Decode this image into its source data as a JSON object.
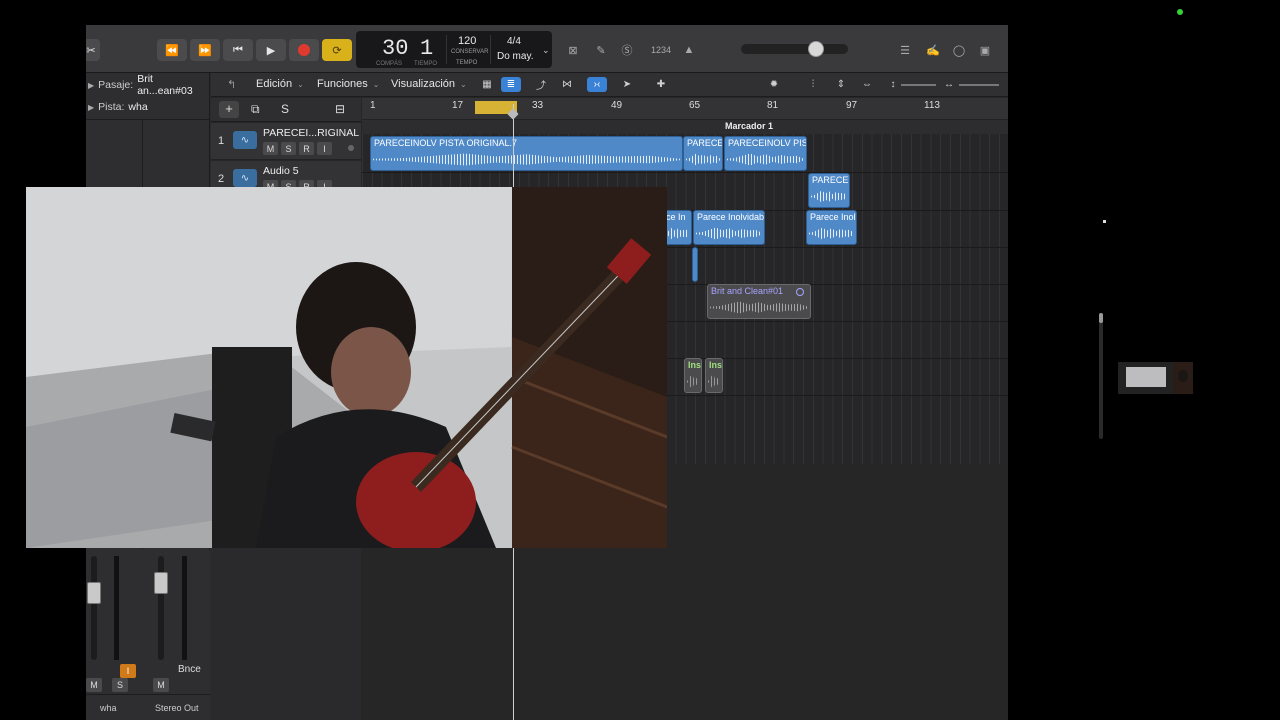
{
  "transport": {
    "rewind_icon": "⏪",
    "forward_icon": "⏩",
    "to_start_icon": "⏮",
    "play_icon": "▶",
    "cycle_icon": "⟳"
  },
  "lcd": {
    "bar": "30",
    "beat": "1",
    "bar_label": "COMPÁS",
    "beat_label": "TIEMPO",
    "tempo": "120",
    "tempo_mode": "CONSERVAR",
    "tempo_label": "TEMPO",
    "signature": "4/4",
    "key": "Do may."
  },
  "control_tools": {
    "count_in": "1234"
  },
  "inspector": {
    "region_label": "Pasaje:",
    "region_value": "Brit an...ean#03",
    "track_label": "Pista:",
    "track_value": "wha"
  },
  "tracks_toolbar": {
    "edit": "Edición",
    "functions": "Funciones",
    "view": "Visualización"
  },
  "ruler": {
    "ticks": [
      "1",
      "17",
      "33",
      "49",
      "65",
      "81",
      "97",
      "113"
    ],
    "marker": "Marcador 1"
  },
  "tracks": [
    {
      "number": "1",
      "name": "PARECEI...RIGINAL",
      "m": "M",
      "s": "S",
      "r": "R",
      "i": "I"
    },
    {
      "number": "2",
      "name": "Audio 5",
      "m": "M",
      "s": "S",
      "r": "R",
      "i": "I"
    }
  ],
  "regions": {
    "r1": "PARECEINOLV PISTA ORIGINAL.7",
    "r2": "PARECEI",
    "r3": "PARECEINOLV PIST",
    "r4": "PARECEI",
    "r5": "ce In",
    "r6": "Parece Inolvidab",
    "r7": "Parece Inol",
    "r8": "Brit and Clean#01",
    "r9": "Ins",
    "r10": "Ins"
  },
  "mixer": {
    "ch1_name": "wha",
    "ch2_name": "Stereo Out",
    "bounce": "Bnce",
    "m": "M",
    "s": "S",
    "i": "I"
  },
  "header_buttons": {
    "add": "+",
    "s": "S"
  }
}
